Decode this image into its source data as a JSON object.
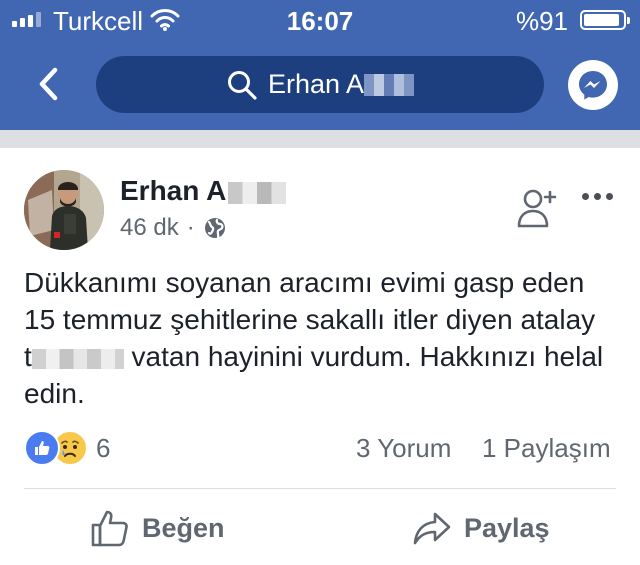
{
  "status_bar": {
    "carrier": "Turkcell",
    "time": "16:07",
    "battery_percent": "%91",
    "battery_level": 0.91
  },
  "header": {
    "search_text": "Erhan A",
    "back_icon": "chevron-left-icon",
    "messenger_icon": "messenger-icon",
    "accent_color": "#4267b2"
  },
  "post": {
    "author_name": "Erhan A",
    "time_ago": "46 dk",
    "separator": "·",
    "privacy_icon": "globe-icon",
    "text_line1": "Dükkanımı soyanan aracımı evimi gasp eden",
    "text_line2": "15 temmuz şehitlerine sakallı itler diyen atalay",
    "text_line3_start": "t",
    "text_line3_end": " vatan hayinini vurdum. Hakkınızı  helal",
    "text_line4": "edin.",
    "reaction_count": "6",
    "comments": "3 Yorum",
    "shares": "1 Paylaşım",
    "like_label": "Beğen",
    "share_label": "Paylaş"
  }
}
